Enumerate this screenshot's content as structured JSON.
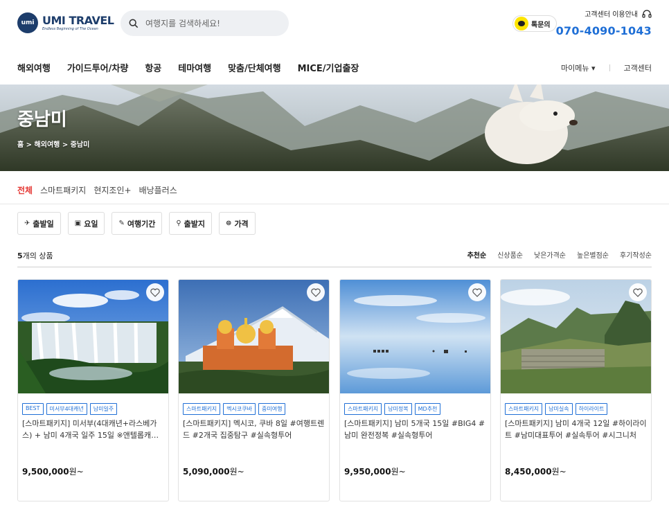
{
  "header": {
    "logo_mark": "umi",
    "logo_name": "UMI TRAVEL",
    "logo_tagline": "Endless Beginning of The Ocean",
    "search_placeholder": "여행지를 검색하세요!",
    "kakao_label": "톡문의",
    "cs_label": "고객센터 이용안내",
    "cs_phone": "070-4090-1043"
  },
  "nav": {
    "items": [
      "해외여행",
      "가이드투어/차량",
      "항공",
      "테마여행",
      "맞춤/단체여행",
      "MICE/기업출장"
    ],
    "my_menu": "마이메뉴 ▾",
    "customer_center": "고객센터"
  },
  "banner": {
    "title": "중남미",
    "breadcrumb": "홈 > 해외여행 > 중남미"
  },
  "category_tabs": [
    "전체",
    "스마트패키지",
    "현지조인+",
    "배낭플러스"
  ],
  "filters": [
    {
      "icon": "plane-icon",
      "label": "출발일"
    },
    {
      "icon": "calendar-icon",
      "label": "요일"
    },
    {
      "icon": "pencil-icon",
      "label": "여행기간"
    },
    {
      "icon": "pin-icon",
      "label": "출발지"
    },
    {
      "icon": "coin-icon",
      "label": "가격"
    }
  ],
  "results": {
    "count": "5",
    "count_suffix": "개의 상품",
    "sorts": [
      "추천순",
      "신상품순",
      "낮은가격순",
      "높은별점순",
      "후기작성순"
    ]
  },
  "products": [
    {
      "tags": [
        "BEST",
        "미서부4대캐년",
        "남미일주"
      ],
      "title": "[스마트패키지] 미서부(4대캐년+라스베가스) + 남미 4개국 일주 15일 ※앤텔롭캐년 포함",
      "price": "9,500,000",
      "unit": "원~"
    },
    {
      "tags": [
        "스마트패키지",
        "멕시코쿠바",
        "중미여행"
      ],
      "title": "[스마트패키지] 멕시코, 쿠바 8일 #여행트렌드 #2개국 집중탐구 #실속형투어",
      "price": "5,090,000",
      "unit": "원~"
    },
    {
      "tags": [
        "스마트패키지",
        "남미정복",
        "MD추천"
      ],
      "title": "[스마트패키지] 남미 5개국 15일 #BIG4 #남미 완전정복 #실속형투어",
      "price": "9,950,000",
      "unit": "원~"
    },
    {
      "tags": [
        "스마트패키지",
        "남미실속",
        "하이라이트"
      ],
      "title": "[스마트패키지] 남미 4개국 12일 #하이라이트 #남미대표투어 #실속투어 #시그니처",
      "price": "8,450,000",
      "unit": "원~"
    }
  ],
  "colors": {
    "accent": "#1f6fd6",
    "active_tab": "#e53935",
    "brand": "#1d3d6b",
    "kakao": "#fee500"
  }
}
